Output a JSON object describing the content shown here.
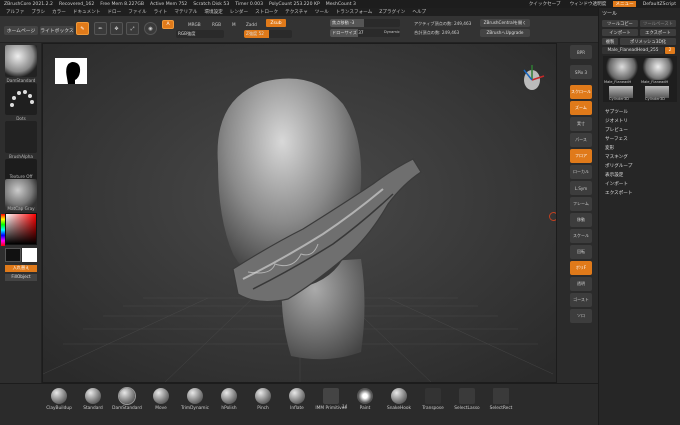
{
  "titlebar": {
    "items": [
      "ZBrushCore 2021.2.2",
      "Recovered_162",
      "Free Mem 8.227GB",
      "Active Mem 752",
      "Scratch Disk 53",
      "Timer 0.003",
      "PolyCount 253.220 KP",
      "MeshCount 3"
    ],
    "right_buttons": [
      "クイックセーブ",
      "ウィンドウ透明度",
      "メニュー",
      "DefaultZScript"
    ]
  },
  "menubar": {
    "items": [
      "アルファ",
      "ブラシ",
      "カラー",
      "ドキュメント",
      "ドロー",
      "ファイル",
      "ライト",
      "マテリアル",
      "環境設定",
      "レンダー",
      "ストローク",
      "テクスチャ",
      "ツール",
      "トランスフォーム",
      "Zプラグイン",
      "ヘルプ"
    ]
  },
  "toolbar": {
    "home_label": "ホームページ",
    "lightbox_label": "ライトボックス",
    "edit_icon": "Edit",
    "draw_icon": "Draw",
    "move_icon": "Move",
    "scale_icon": "Scale",
    "rotate_icon": "Rotate",
    "a_label": "A",
    "mrgb_label": "MRGB",
    "rgb_label": "RGB",
    "m_label": "M",
    "zadd_label": "Zadd",
    "zsub_label": "Zsub",
    "rgb_intensity_label": "RGB強度",
    "z_intensity_label": "Z強度 52",
    "focal_label": "焦点移動 -3",
    "draw_size_label": "ドローサイズ 37",
    "dynamic_label": "Dynamic",
    "active_points": "アクティブ頂点の数: 249,463",
    "total_points": "合計頂点の数: 249,463",
    "zbrushcentral": "ZBrushCentralを開く",
    "upgrade": "ZBrushへUpgrade"
  },
  "leftpanel": {
    "items": [
      "DamStandard",
      "Dots",
      "BrushAlpha",
      "Texture Off",
      "MatCap Gray"
    ],
    "swap_label": "入れ替え",
    "fillobject_label": "FillObject"
  },
  "rightstrip": {
    "items": [
      "BPR",
      "SPix 3",
      "スクロール",
      "ズーム",
      "実寸",
      "パース",
      "フロア",
      "ローカル",
      "L.Sym",
      "フレーム",
      "移動",
      "スケール",
      "回転",
      "ポリF",
      "透明",
      "ゴースト",
      "ソロ"
    ]
  },
  "rightpanel": {
    "title": "ツール",
    "tool_copy": "ツールコピー",
    "tool_paste": "ツールペースト",
    "import": "インポート",
    "export": "エクスポート",
    "duplicate": "複製",
    "polymesh": "ポリメッシュ3D化",
    "current_tool": "Male_FlaneadHead_255",
    "current_count": "2",
    "thumbs": [
      "Male_FlaneadH",
      "Male_FlaneadH",
      "Cylinder3D",
      "Cylinder3D"
    ],
    "menu": [
      "サブツール",
      "ジオメトリ",
      "プレビュー",
      "サーフェス",
      "変形",
      "マスキング",
      "ポリグループ",
      "表示設定",
      "インポート",
      "エクスポート"
    ]
  },
  "bottombar": {
    "brushes": [
      "ClayBuildup",
      "Standard",
      "DamStandard",
      "Move",
      "TrimDynamic",
      "hPolish",
      "Pinch",
      "Inflate",
      "IMM Primitives",
      "Paint",
      "SnakeHook",
      "Transpose",
      "SelectLasso",
      "SelectRect"
    ],
    "imm_count": "14"
  },
  "colors": {
    "accent": "#e07a1a",
    "panel": "#2b2b2b",
    "viewport": "#2e2e2e"
  }
}
